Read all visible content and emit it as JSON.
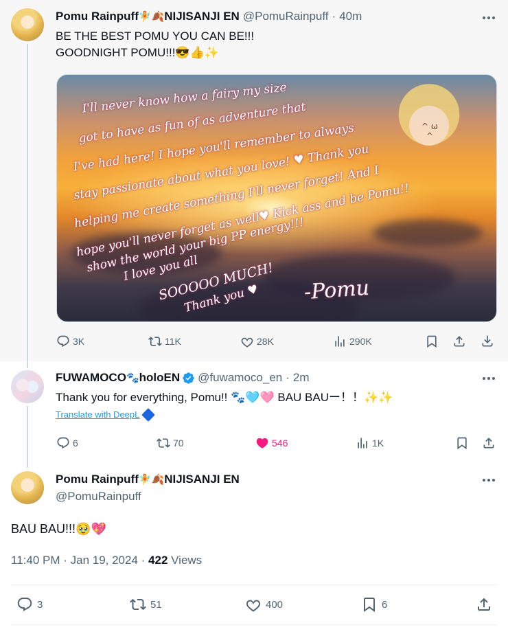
{
  "tweet1": {
    "name": "Pomu Rainpuff",
    "name_emoji": "🧚🍂",
    "org": "NIJISANJI EN",
    "handle": "@PomuRainpuff",
    "time": "40m",
    "text": "BE THE BEST POMU YOU CAN BE!!!\nGOODNIGHT POMU!!!😎👍✨",
    "image_handwriting": [
      "I'll never know how a fairy my size",
      "got to have as fun of as adventure that",
      "I've had here! I hope you'll remember to always",
      "stay passionate about what you love! ♥ Thank you",
      "helping me create something I'll never forget! And I",
      "hope you'll never forget as well♥ Kick ass and be Pomu!!",
      "show the world your big PP energy!!!",
      "I love you all",
      "SOOOOO MUCH!",
      "Thank you ♥",
      "-Pomu"
    ],
    "stats": {
      "replies": "3K",
      "reposts": "11K",
      "likes": "28K",
      "views": "290K"
    }
  },
  "tweet2": {
    "name": "FUWAMOCO",
    "name_emoji": "🐾",
    "org": "holoEN",
    "handle": "@fuwamoco_en",
    "time": "2m",
    "text": "Thank you for everything, Pomu!! 🐾🩵🩷 BAU BAUー！！✨✨",
    "translate": "Translate with DeepL",
    "stats": {
      "replies": "6",
      "reposts": "70",
      "likes": "546",
      "views": "1K"
    },
    "like_color": "#f91880"
  },
  "tweet3": {
    "name": "Pomu Rainpuff",
    "name_emoji": "🧚🍂",
    "org": "NIJISANJI EN",
    "handle": "@PomuRainpuff",
    "text": "BAU BAU!!!🥹💖",
    "timestamp": "11:40 PM · Jan 19, 2024 · ",
    "views_count": "422",
    "views_label": " Views",
    "stats": {
      "replies": "3",
      "reposts": "51",
      "likes": "400",
      "bookmarks": "6"
    }
  },
  "icons": {
    "more": "more-icon",
    "reply": "reply-icon",
    "repost": "repost-icon",
    "like": "heart-icon",
    "views": "views-icon",
    "bookmark": "bookmark-icon",
    "share": "share-icon",
    "download": "download-icon",
    "verified": "verified-badge-icon"
  },
  "colors": {
    "muted": "#536471",
    "text": "#0f1419",
    "link": "#1d9bf0",
    "like": "#f91880",
    "verified": "#1d9bf0",
    "highlight_bg": "#f7f7f7"
  }
}
